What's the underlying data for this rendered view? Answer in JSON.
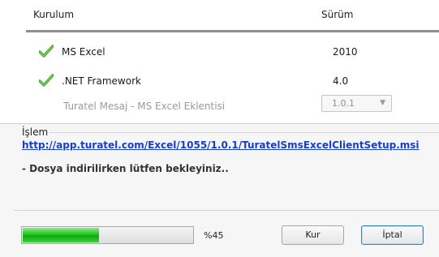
{
  "header": {
    "col_install": "Kurulum",
    "col_version": "Sürüm"
  },
  "components": [
    {
      "name": "MS Excel",
      "version": "2010",
      "installed": true
    },
    {
      "name": ".NET Framework",
      "version": "4.0",
      "installed": true
    },
    {
      "name": "Turatel Mesaj - MS Excel Eklentisi",
      "version": "1.0.1",
      "installed": false
    }
  ],
  "process": {
    "legend": "İşlem",
    "url": "http://app.turatel.com/Excel/1055/1.0.1/TuratelSmsExcelClientSetup.msi",
    "status": "- Dosya indirilirken lütfen bekleyiniz.."
  },
  "progress": {
    "value_percent": 45,
    "label": "%45"
  },
  "buttons": {
    "install": "Kur",
    "cancel": "İptal"
  },
  "colors": {
    "check": "#3fb52b",
    "link": "#1740c8",
    "progress": "#22c422"
  },
  "icons": {
    "installed": "check-icon"
  }
}
